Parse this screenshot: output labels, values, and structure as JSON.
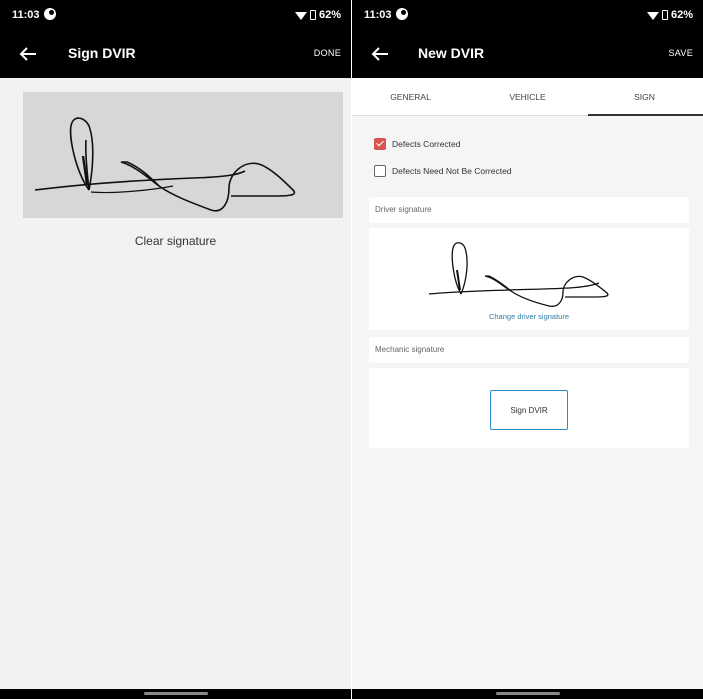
{
  "status_bar": {
    "left_time": "11:03",
    "left_battery": "62%",
    "right_time": "11:03",
    "right_battery": "62%"
  },
  "sign_screen": {
    "title": "Sign DVIR",
    "action": "DONE",
    "clear_label": "Clear signature"
  },
  "dvir_screen": {
    "title": "New DVIR",
    "action": "SAVE",
    "tabs": [
      {
        "label": "GENERAL"
      },
      {
        "label": "VEHICLE"
      },
      {
        "label": "SIGN"
      }
    ],
    "selected_tab": "SIGN",
    "options": [
      {
        "label": "Defects Corrected",
        "checked": true
      },
      {
        "label": "Defects Need Not Be Corrected",
        "checked": false
      }
    ],
    "driver_header": "Driver signature",
    "change_label": "Change driver signature",
    "mechanic_header": "Mechanic signature",
    "sign_button": "Sign DVIR"
  },
  "colors": {
    "app_bar": "#000000",
    "accent": "#2b8cc4",
    "checkbox_checked": "#d9534f",
    "signature_pad": "#d8d6d6"
  },
  "icons": {
    "back": "arrow-left-icon",
    "wifi": "wifi-icon",
    "battery": "battery-icon"
  }
}
